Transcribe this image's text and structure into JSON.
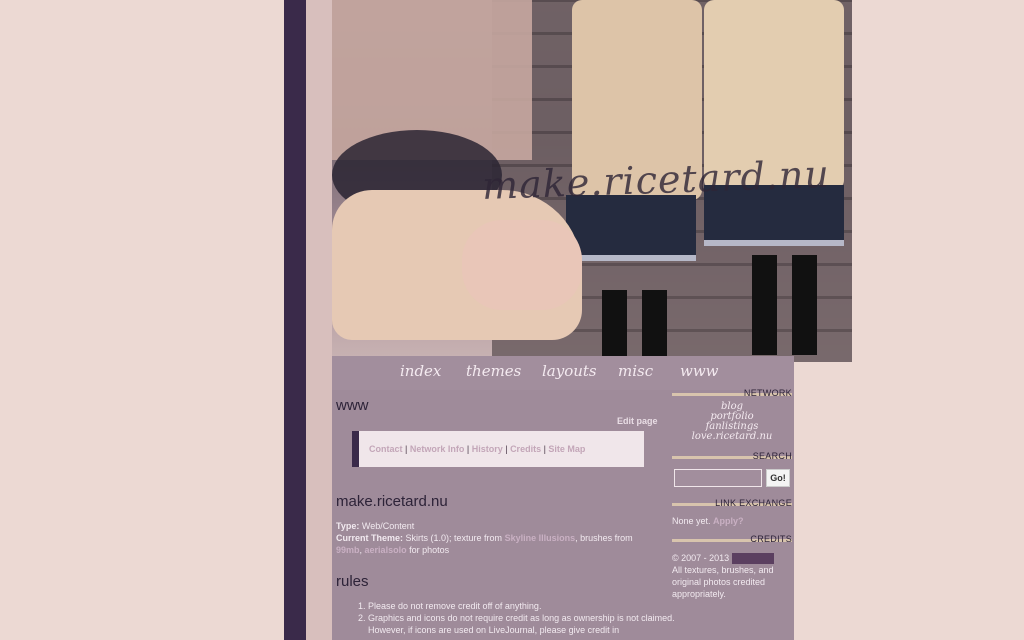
{
  "site": {
    "title": "make.ricetard.nu"
  },
  "nav": [
    {
      "label": "index"
    },
    {
      "label": "themes"
    },
    {
      "label": "layouts"
    },
    {
      "label": "misc"
    },
    {
      "label": "www"
    }
  ],
  "page": {
    "title": "www",
    "edit_label": "Edit page",
    "subnav": [
      "Contact",
      "Network Info",
      "History",
      "Credits",
      "Site Map"
    ]
  },
  "site_info": {
    "heading": "make.ricetard.nu",
    "type_label": "Type:",
    "type_value": "Web/Content",
    "theme_label": "Current Theme:",
    "theme_prefix": "Skirts (1.0); texture from",
    "theme_link1": "Skyline Illusions",
    "theme_mid": ", brushes from",
    "theme_link2": "99mb",
    "theme_sep": ",",
    "theme_link3": "aerialsolo",
    "theme_suffix": "for photos"
  },
  "rules": {
    "heading": "rules",
    "items": [
      "Please do not remove credit off of anything.",
      "Graphics and icons do not require credit as long as ownership is not claimed. However, if icons are used on LiveJournal, please give credit in"
    ]
  },
  "sidebar": {
    "network": {
      "heading": "NETWORK",
      "links": [
        "blog",
        "portfolio",
        "fanlistings",
        "love.ricetard.nu"
      ]
    },
    "search": {
      "heading": "SEARCH",
      "input_value": "",
      "button_label": "Go!"
    },
    "link_exchange": {
      "heading": "LINK EXCHANGE",
      "text": "None yet.",
      "link": "Apply?"
    },
    "credits": {
      "heading": "CREDITS",
      "copyright": "© 2007 - 2013",
      "text": "All textures, brushes, and original photos credited appropriately."
    }
  }
}
